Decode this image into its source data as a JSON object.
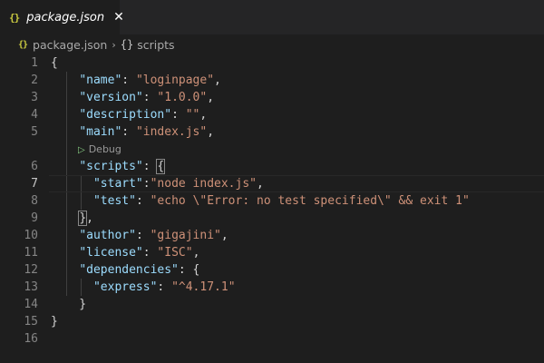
{
  "tab": {
    "filename": "package.json",
    "icon": "json-icon",
    "close": "✕"
  },
  "breadcrumb": {
    "file": "package.json",
    "separator": "›",
    "symbol_icon": "{}",
    "symbol": "scripts"
  },
  "codelens": {
    "label": "Debug"
  },
  "lines": [
    {
      "num": "1"
    },
    {
      "num": "2",
      "key": "\"name\"",
      "value": "\"loginpage\""
    },
    {
      "num": "3",
      "key": "\"version\"",
      "value": "\"1.0.0\""
    },
    {
      "num": "4",
      "key": "\"description\"",
      "value": "\"\""
    },
    {
      "num": "5",
      "key": "\"main\"",
      "value": "\"index.js\""
    },
    {
      "num": "6",
      "key": "\"scripts\""
    },
    {
      "num": "7",
      "key": "\"start\"",
      "value": "\"node index.js\""
    },
    {
      "num": "8",
      "key": "\"test\"",
      "value": "\"echo \\\"Error: no test specified\\\" && exit 1\""
    },
    {
      "num": "9"
    },
    {
      "num": "10",
      "key": "\"author\"",
      "value": "\"gigajini\""
    },
    {
      "num": "11",
      "key": "\"license\"",
      "value": "\"ISC\""
    },
    {
      "num": "12",
      "key": "\"dependencies\""
    },
    {
      "num": "13",
      "key": "\"express\"",
      "value": "\"^4.17.1\""
    },
    {
      "num": "14"
    },
    {
      "num": "15"
    },
    {
      "num": "16"
    }
  ],
  "active_line": "7",
  "colors": {
    "key": "#9cdcfe",
    "string": "#ce9178",
    "background": "#1e1e1e",
    "tab_bar": "#252526"
  }
}
